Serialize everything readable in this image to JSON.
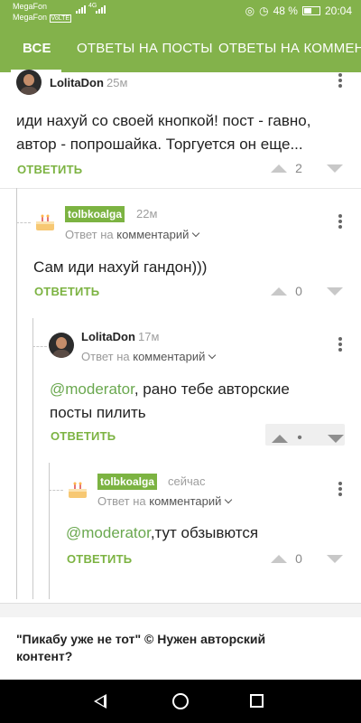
{
  "status_bar": {
    "carrier_1": "MegaFon",
    "carrier_2": "MegaFon",
    "network_badge": "VoLTE",
    "network_type": "4G",
    "battery": "48 %",
    "time": "20:04"
  },
  "tabs": [
    {
      "label": "ВСЕ",
      "active": true
    },
    {
      "label": "ОТВЕТЫ НА ПОСТЫ",
      "active": false
    },
    {
      "label": "ОТВЕТЫ НА КОММЕНТ",
      "active": false
    }
  ],
  "comments": [
    {
      "author": "LolitaDon",
      "time": "25м",
      "text": "иди нахуй со своей кнопкой! пост - гавно, автор - попрошайка. Торгуется он еще...",
      "reply_label": "ОТВЕТИТЬ",
      "score": "2"
    },
    {
      "author": "tolbkoalga",
      "time": "22м",
      "reply_prefix": "Ответ на",
      "reply_target": "комментарий",
      "text": "Сам иди нахуй гандон)))",
      "reply_label": "ОТВЕТИТЬ",
      "score": "0"
    },
    {
      "author": "LolitaDon",
      "time": "17м",
      "reply_prefix": "Ответ на",
      "reply_target": "комментарий",
      "mention": "@moderator",
      "text": ", рано тебе авторские посты пилить",
      "reply_label": "ОТВЕТИТЬ",
      "score": "•"
    },
    {
      "author": "tolbkoalga",
      "time": "сейчас",
      "reply_prefix": "Ответ на",
      "reply_target": "комментарий",
      "mention": "@moderator",
      "text": ",тут обзывются",
      "reply_label": "ОТВЕТИТЬ",
      "score": "0"
    }
  ],
  "related_post": {
    "title": "\"Пикабу уже не тот\" © Нужен авторский контент?"
  },
  "colors": {
    "brand": "#83b24b",
    "accent_text": "#7cb342"
  }
}
